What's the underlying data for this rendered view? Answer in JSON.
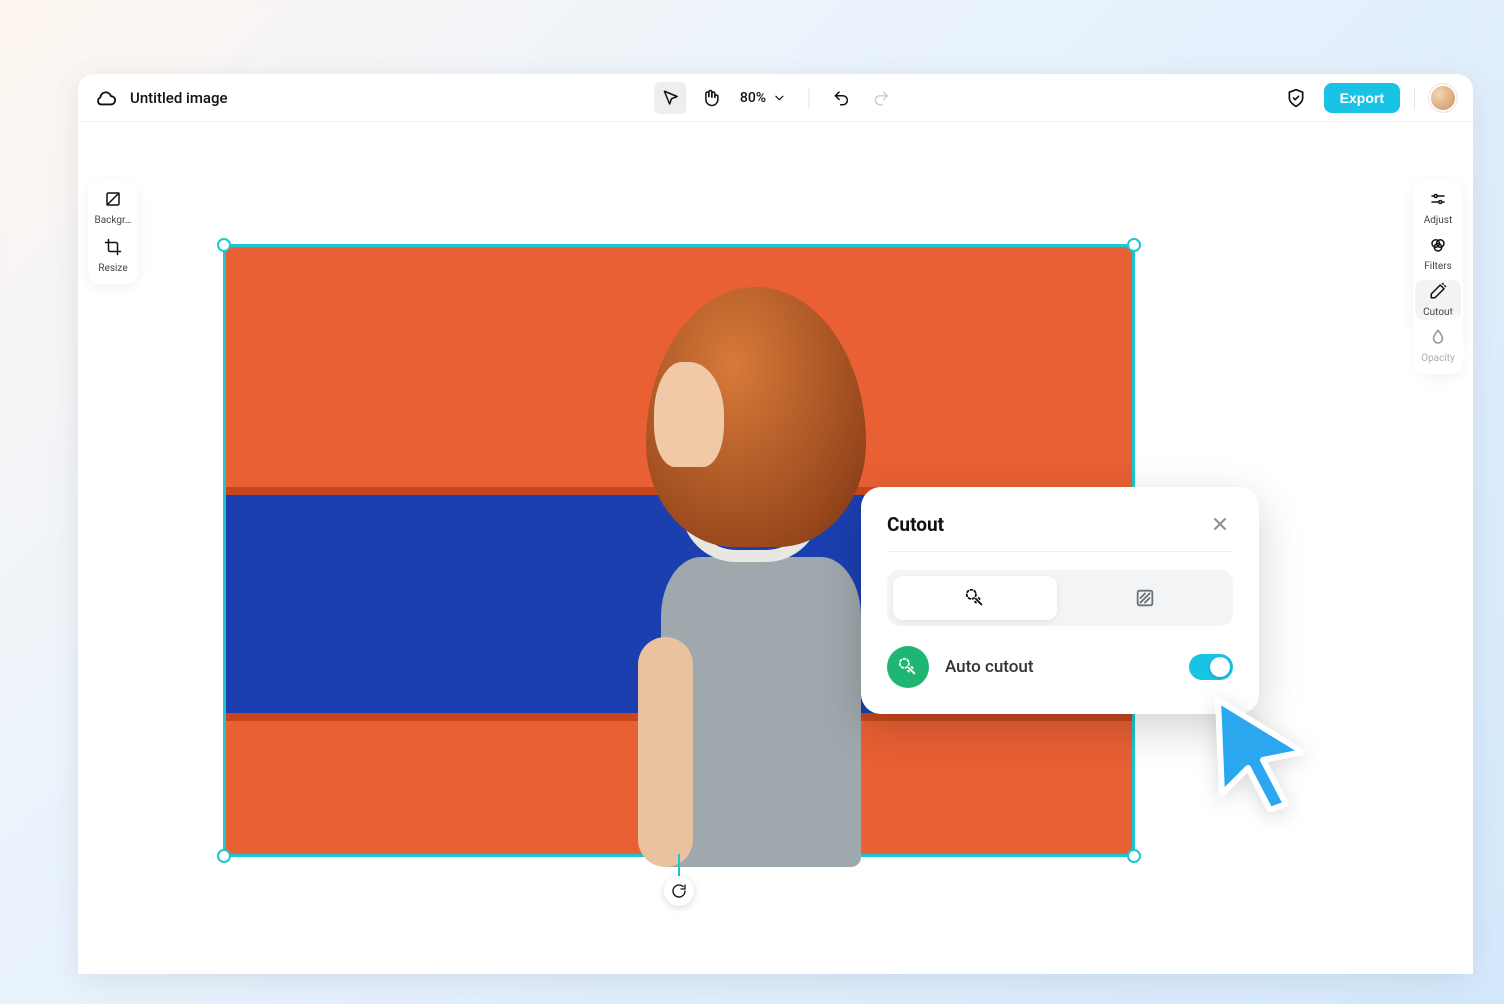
{
  "header": {
    "title": "Untitled image",
    "zoom": "80%",
    "export_label": "Export"
  },
  "left_sidebar": {
    "items": [
      {
        "label": "Backgr…"
      },
      {
        "label": "Resize"
      }
    ]
  },
  "right_sidebar": {
    "items": [
      {
        "label": "Adjust"
      },
      {
        "label": "Filters"
      },
      {
        "label": "Cutout"
      },
      {
        "label": "Opacity"
      }
    ],
    "selected_index": 2
  },
  "cutout_panel": {
    "title": "Cutout",
    "auto_label": "Auto cutout",
    "toggle_on": true,
    "active_tab_index": 0
  },
  "colors": {
    "accent": "#19c3e6",
    "selection": "#1cc8cf",
    "success": "#1fb573"
  }
}
